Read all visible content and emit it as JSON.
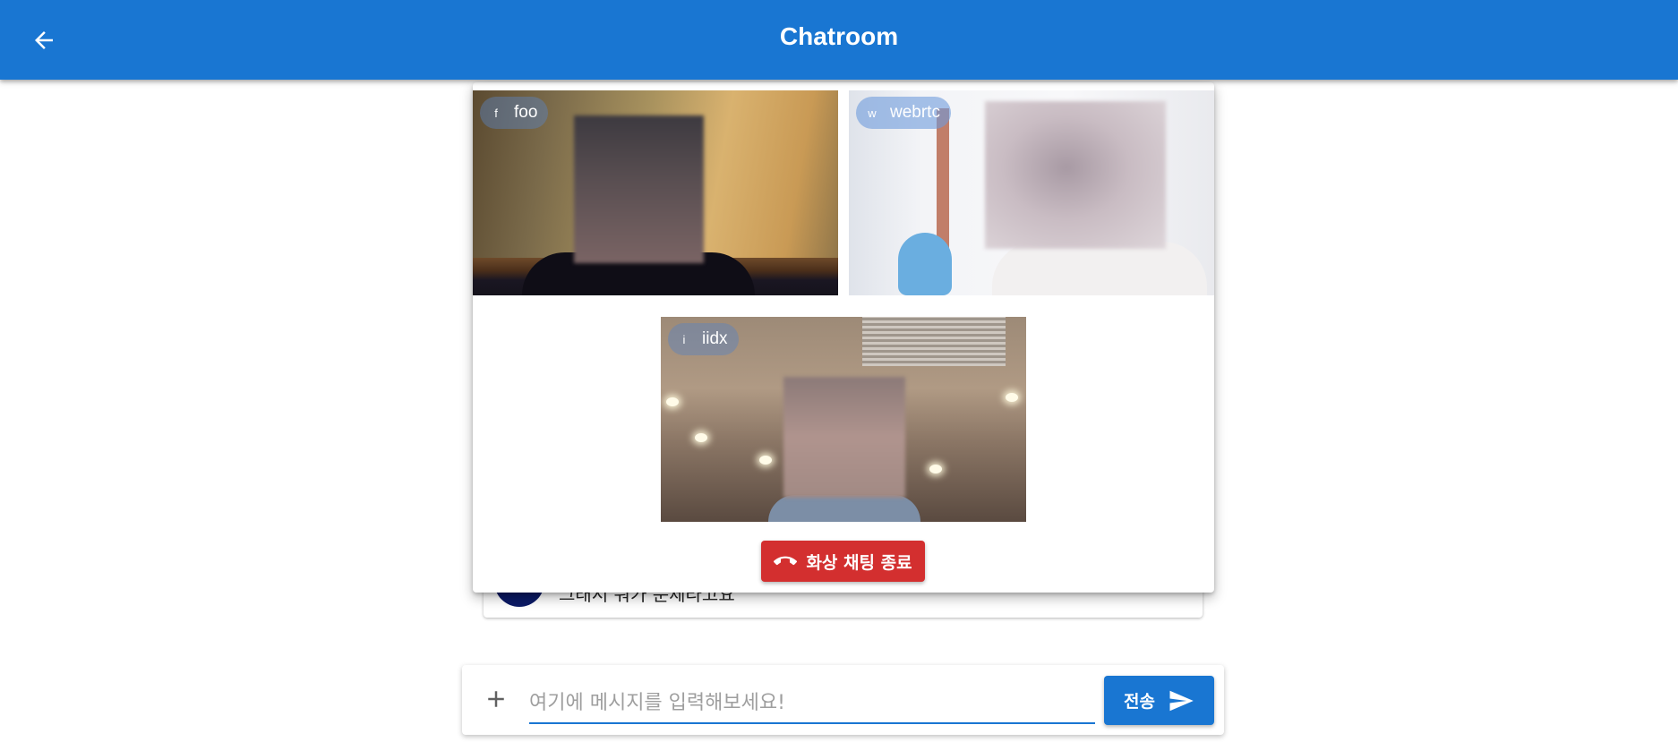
{
  "app_bar": {
    "title": "Chatroom",
    "back_icon": "arrow-left-icon",
    "color": "#1976d2"
  },
  "background_message": {
    "text": "그래서 뭐가 문제라고요"
  },
  "video_call": {
    "participants": [
      {
        "initial": "f",
        "name": "foo"
      },
      {
        "initial": "w",
        "name": "webrtc"
      },
      {
        "initial": "i",
        "name": "iidx"
      }
    ],
    "end_call_label": "화상 채팅 종료",
    "end_call_icon": "call-end-icon",
    "end_call_color": "#d32f2f"
  },
  "composer": {
    "attach_icon": "plus-icon",
    "placeholder": "여기에 메시지를 입력해보세요!",
    "value": "",
    "send_label": "전송",
    "send_icon": "send-icon"
  }
}
